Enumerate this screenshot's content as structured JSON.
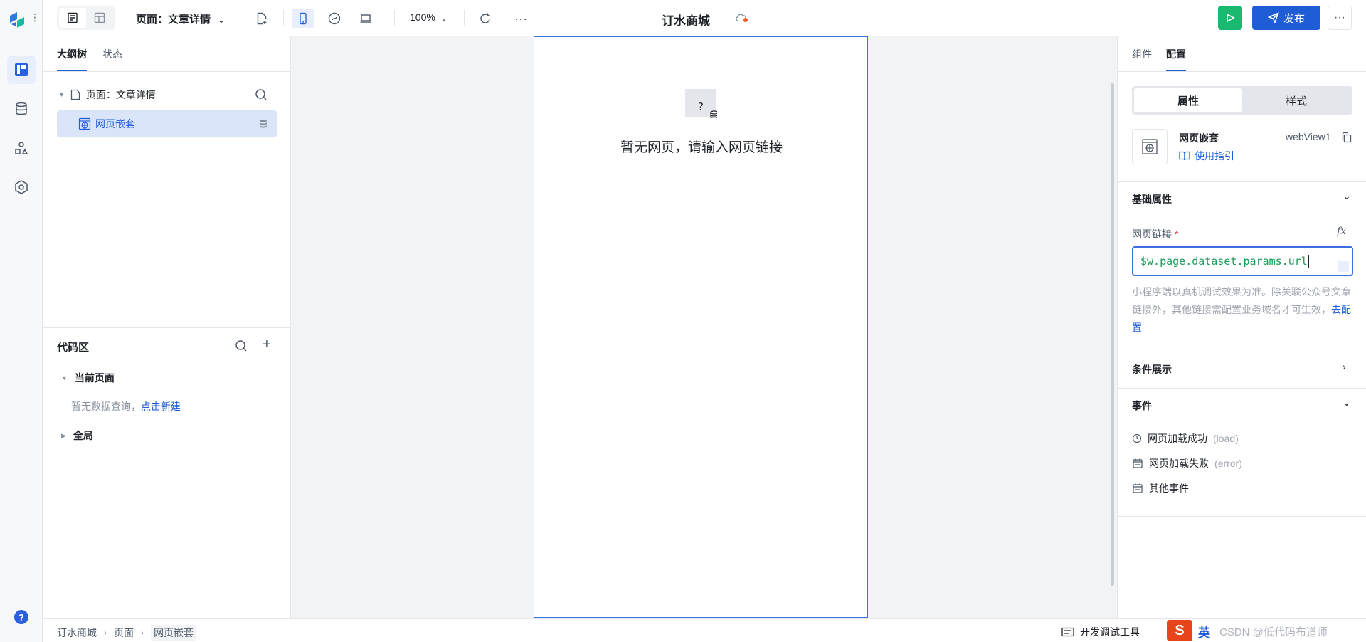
{
  "toolbar": {
    "page_select": "页面：文章详情",
    "zoom": "100%",
    "app_title": "订水商城",
    "publish_label": "发布",
    "more_label": "···"
  },
  "left_panel": {
    "tabs": [
      {
        "label": "大纲树"
      },
      {
        "label": "状态"
      }
    ],
    "tree_root": "页面：文章详情",
    "tree_node": "网页嵌套",
    "code_title": "代码区",
    "current_page": "当前页面",
    "empty_text": "暂无数据查询，",
    "empty_link": "点击新建",
    "global": "全局"
  },
  "canvas": {
    "placeholder_text": "暂无网页，请输入网页链接"
  },
  "right_panel": {
    "tabs": [
      {
        "label": "组件"
      },
      {
        "label": "配置"
      }
    ],
    "seg": [
      {
        "label": "属性"
      },
      {
        "label": "样式"
      }
    ],
    "component_name": "网页嵌套",
    "component_guide": "使用指引",
    "component_id": "webView1",
    "sections": {
      "basic": "基础属性",
      "condition": "条件展示",
      "events": "事件"
    },
    "field_label": "网页链接",
    "field_required": "*",
    "fx": "fx",
    "url_value": "$w.page.dataset.params.url",
    "help_text": "小程序端以真机调试效果为准。除关联公众号文章链接外，其他链接需配置业务域名才可生效，",
    "help_link": "去配置",
    "events": [
      {
        "name": "网页加载成功",
        "tag": "(load)"
      },
      {
        "name": "网页加载失败",
        "tag": "(error)"
      },
      {
        "name": "其他事件",
        "tag": ""
      }
    ]
  },
  "statusbar": {
    "breadcrumb": [
      "订水商城",
      "页面",
      "网页嵌套"
    ],
    "devtools": "开发调试工具",
    "ime_label": "S",
    "ime_lang": "英",
    "watermark": "CSDN @低代码布道师"
  },
  "colors": {
    "accent": "#1f5dd6",
    "run_green": "#1bb96f",
    "url_text": "#1a9c5a",
    "selection_bg": "#dbe5fa"
  }
}
